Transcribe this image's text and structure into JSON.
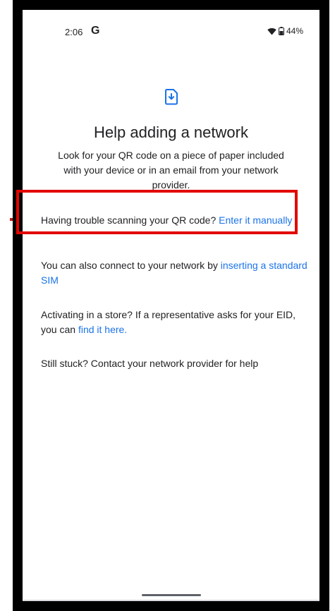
{
  "status_bar": {
    "time": "2:06",
    "google_badge": "G",
    "battery": "44%",
    "icons": [
      "wifi-icon",
      "battery-icon"
    ]
  },
  "page": {
    "icon": "sim-download-icon",
    "title": "Help adding a network",
    "subtitle": "Look for your QR code on a piece of paper included with your device or in an email from your network provider."
  },
  "help_items": [
    {
      "text": "Having trouble scanning your QR code? ",
      "link": "Enter it manually"
    },
    {
      "text": "You can also connect to your network by ",
      "link": "inserting a standard SIM"
    },
    {
      "text": "Activating in a store? If a representative asks for your EID, you can ",
      "link": "find it here."
    },
    {
      "text": "Still stuck? Contact your network provider for help",
      "link": ""
    }
  ],
  "colors": {
    "link": "#1a73e8",
    "text": "#202124",
    "highlight": "#e10600",
    "accent_icon": "#1a73e8"
  }
}
